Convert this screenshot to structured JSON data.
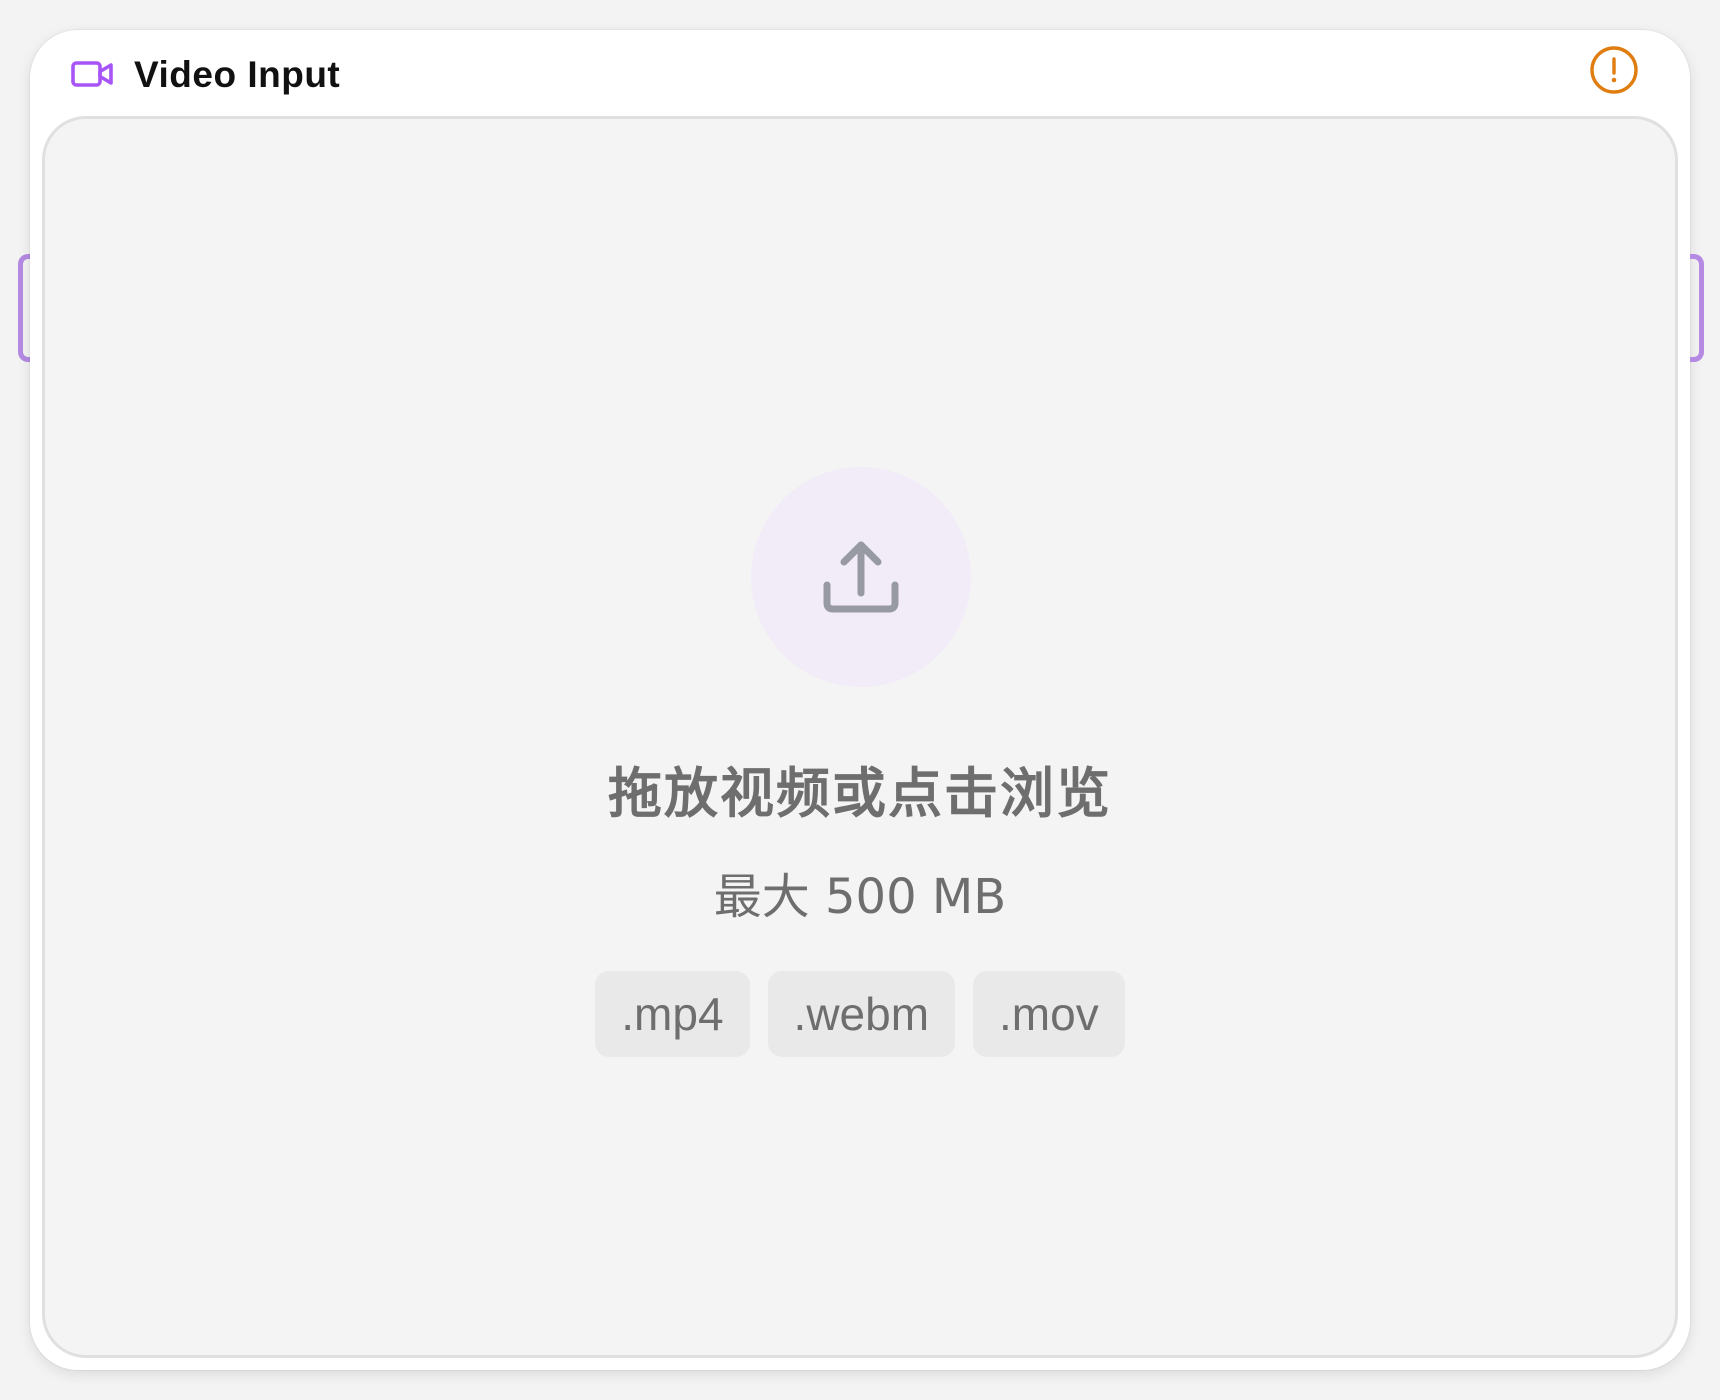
{
  "node": {
    "title": "Video Input",
    "header_icon": "video-camera-icon",
    "status_icon": "warning-icon",
    "colors": {
      "accent": "#a855f7",
      "warning": "#e07d10",
      "handle": "#b48ae3"
    }
  },
  "dropzone": {
    "icon": "upload-icon",
    "title": "拖放视频或点击浏览",
    "subtitle": "最大 500 MB",
    "formats": [
      ".mp4",
      ".webm",
      ".mov"
    ]
  }
}
